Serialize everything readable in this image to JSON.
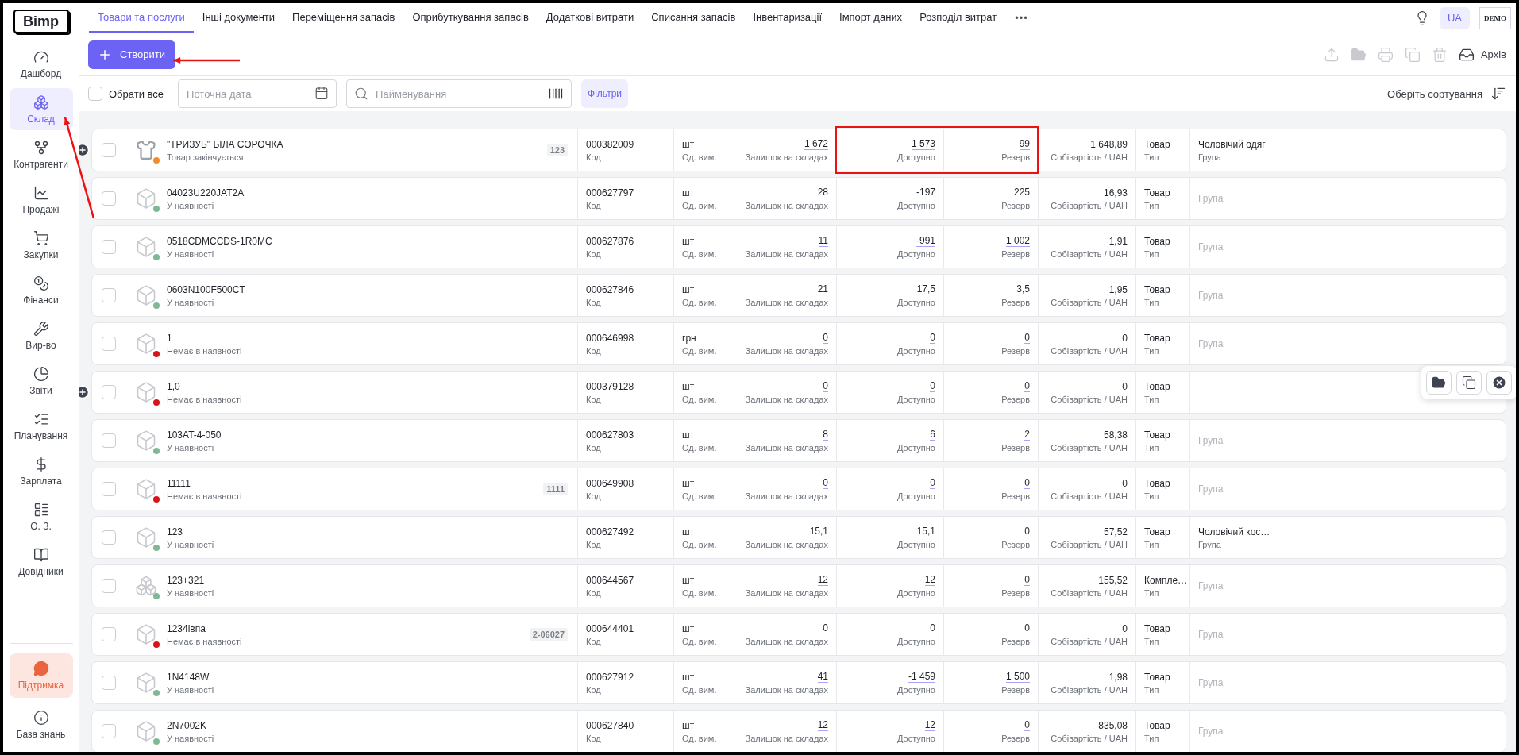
{
  "logo": "Bimp",
  "sidebar": {
    "items": [
      {
        "label": "Дашборд",
        "selected": false,
        "annotated": false
      },
      {
        "label": "Склад",
        "selected": true,
        "annotated": true
      },
      {
        "label": "Контрагенти",
        "selected": false,
        "annotated": false
      },
      {
        "label": "Продажі",
        "selected": false,
        "annotated": false
      },
      {
        "label": "Закупки",
        "selected": false,
        "annotated": false
      },
      {
        "label": "Фінанси",
        "selected": false,
        "annotated": false
      },
      {
        "label": "Вир-во",
        "selected": false,
        "annotated": false
      },
      {
        "label": "Звіти",
        "selected": false,
        "annotated": false
      },
      {
        "label": "Планування",
        "selected": false,
        "annotated": false
      },
      {
        "label": "Зарплата",
        "selected": false,
        "annotated": false
      },
      {
        "label": "О. З.",
        "selected": false,
        "annotated": false
      },
      {
        "label": "Довідники",
        "selected": false,
        "annotated": false
      }
    ],
    "bottom": [
      {
        "label": "Підтримка",
        "kind": "support"
      },
      {
        "label": "База знань",
        "kind": "plain"
      }
    ]
  },
  "tabs": [
    {
      "label": "Товари та послуги",
      "selected": true
    },
    {
      "label": "Інші документи",
      "selected": false
    },
    {
      "label": "Переміщення запасів",
      "selected": false
    },
    {
      "label": "Оприбуткування запасів",
      "selected": false
    },
    {
      "label": "Додаткові витрати",
      "selected": false
    },
    {
      "label": "Списання запасів",
      "selected": false
    },
    {
      "label": "Інвентаризації",
      "selected": false
    },
    {
      "label": "Імпорт даних",
      "selected": false
    },
    {
      "label": "Розподіл витрат",
      "selected": false
    }
  ],
  "tabs_more": "•••",
  "language": "UA",
  "account_logo": "DEMO",
  "toolbar": {
    "create": {
      "label": "Створити",
      "annotated": true
    },
    "archive": "Архів"
  },
  "filters": {
    "select_all": {
      "label": "Обрати все",
      "checked": false
    },
    "date": {
      "placeholder": "Поточна дата"
    },
    "search": {
      "placeholder": "Найменування"
    },
    "filters_button": "Фільтри",
    "sort": "Оберіть сортування"
  },
  "rows": [
    {
      "name": "\"ТРИЗУБ\" БІЛА СОРОЧКА",
      "status": "Товар закінчується",
      "color": "#f28c28",
      "kind": "shirt",
      "badge": "123",
      "code": "000382009",
      "code_label": "Код",
      "unit": "шт",
      "unit_label": "Од. вим.",
      "stock": "1 672",
      "stock_label": "Залишок на складах",
      "available": "1 573",
      "available_label": "Доступно",
      "reserve": "99",
      "reserve_label": "Резерв",
      "cost": "1 648,89",
      "cost_label": "Собівартість / UAH",
      "type": "Товар",
      "type_label": "Тип",
      "group": "Чоловічий одяг",
      "group_label": "Група",
      "expand_button": true,
      "hovered": false,
      "highlighted": true,
      "checked": false
    },
    {
      "name": "04023U220JAT2A",
      "status": "У наявності",
      "color": "#7fb894",
      "kind": "box",
      "code": "000627797",
      "code_label": "Код",
      "unit": "шт",
      "unit_label": "Од. вим.",
      "stock": "28",
      "stock_label": "Залишок на складах",
      "available": "-197",
      "available_label": "Доступно",
      "reserve": "225",
      "reserve_label": "Резерв",
      "cost": "16,93",
      "cost_label": "Собівартість / UAH",
      "type": "Товар",
      "type_label": "Тип",
      "group_label": "Група",
      "expand_button": false,
      "hovered": false,
      "highlighted": false,
      "checked": false
    },
    {
      "name": "0518CDMCCDS-1R0MC",
      "status": "У наявності",
      "color": "#7fb894",
      "kind": "box",
      "code": "000627876",
      "code_label": "Код",
      "unit": "шт",
      "unit_label": "Од. вим.",
      "stock": "11",
      "stock_label": "Залишок на складах",
      "available": "-991",
      "available_label": "Доступно",
      "reserve": "1 002",
      "reserve_label": "Резерв",
      "cost": "1,91",
      "cost_label": "Собівартість / UAH",
      "type": "Товар",
      "type_label": "Тип",
      "group_label": "Група",
      "expand_button": false,
      "hovered": false,
      "highlighted": false,
      "checked": false
    },
    {
      "name": "0603N100F500CT",
      "status": "У наявності",
      "color": "#7fb894",
      "kind": "box",
      "code": "000627846",
      "code_label": "Код",
      "unit": "шт",
      "unit_label": "Од. вим.",
      "stock": "21",
      "stock_label": "Залишок на складах",
      "available": "17,5",
      "available_label": "Доступно",
      "reserve": "3,5",
      "reserve_label": "Резерв",
      "cost": "1,95",
      "cost_label": "Собівартість / UAH",
      "type": "Товар",
      "type_label": "Тип",
      "group_label": "Група",
      "expand_button": false,
      "hovered": false,
      "highlighted": false,
      "checked": false
    },
    {
      "name": "1",
      "status": "Немає в наявності",
      "color": "#d7141a",
      "kind": "box",
      "code": "000646998",
      "code_label": "Код",
      "unit": "грн",
      "unit_label": "Од. вим.",
      "stock": "0",
      "stock_label": "Залишок на складах",
      "available": "0",
      "available_label": "Доступно",
      "reserve": "0",
      "reserve_label": "Резерв",
      "cost": "0",
      "cost_label": "Собівартість / UAH",
      "type": "Товар",
      "type_label": "Тип",
      "group_label": "Група",
      "expand_button": false,
      "hovered": false,
      "highlighted": false,
      "checked": false
    },
    {
      "name": "1,0",
      "status": "Немає в наявності",
      "color": "#d7141a",
      "kind": "box",
      "code": "000379128",
      "code_label": "Код",
      "unit": "шт",
      "unit_label": "Од. вим.",
      "stock": "0",
      "stock_label": "Залишок на складах",
      "available": "0",
      "available_label": "Доступно",
      "reserve": "0",
      "reserve_label": "Резерв",
      "cost": "0",
      "cost_label": "Собівартість / UAH",
      "type": "Товар",
      "type_label": "Тип",
      "expand_button": true,
      "hovered": true,
      "highlighted": false,
      "checked": false
    },
    {
      "name": "103AT-4-050",
      "status": "У наявності",
      "color": "#7fb894",
      "kind": "box",
      "code": "000627803",
      "code_label": "Код",
      "unit": "шт",
      "unit_label": "Од. вим.",
      "stock": "8",
      "stock_label": "Залишок на складах",
      "available": "6",
      "available_label": "Доступно",
      "reserve": "2",
      "reserve_label": "Резерв",
      "cost": "58,38",
      "cost_label": "Собівартість / UAH",
      "type": "Товар",
      "type_label": "Тип",
      "group_label": "Група",
      "expand_button": false,
      "hovered": false,
      "highlighted": false,
      "checked": false
    },
    {
      "name": "11111",
      "status": "Немає в наявності",
      "color": "#d7141a",
      "kind": "box",
      "badge": "1111",
      "code": "000649908",
      "code_label": "Код",
      "unit": "шт",
      "unit_label": "Од. вим.",
      "stock": "0",
      "stock_label": "Залишок на складах",
      "available": "0",
      "available_label": "Доступно",
      "reserve": "0",
      "reserve_label": "Резерв",
      "cost": "0",
      "cost_label": "Собівартість / UAH",
      "type": "Товар",
      "type_label": "Тип",
      "group_label": "Група",
      "expand_button": false,
      "hovered": false,
      "highlighted": false,
      "checked": false
    },
    {
      "name": "123",
      "status": "У наявності",
      "color": "#7fb894",
      "kind": "box",
      "code": "000627492",
      "code_label": "Код",
      "unit": "шт",
      "unit_label": "Од. вим.",
      "stock": "15,1",
      "stock_label": "Залишок на складах",
      "available": "15,1",
      "available_label": "Доступно",
      "reserve": "0",
      "reserve_label": "Резерв",
      "cost": "57,52",
      "cost_label": "Собівартість / UAH",
      "type": "Товар",
      "type_label": "Тип",
      "group": "Чоловічий кос…",
      "group_label": "Група",
      "expand_button": false,
      "hovered": false,
      "highlighted": false,
      "checked": false
    },
    {
      "name": "123+321",
      "status": "У наявності",
      "color": "#7fb894",
      "kind": "boxes",
      "code": "000644567",
      "code_label": "Код",
      "unit": "шт",
      "unit_label": "Од. вим.",
      "stock": "12",
      "stock_label": "Залишок на складах",
      "available": "12",
      "available_label": "Доступно",
      "reserve": "0",
      "reserve_label": "Резерв",
      "cost": "155,52",
      "cost_label": "Собівартість / UAH",
      "type": "Компле…",
      "type_label": "Тип",
      "group_label": "Група",
      "expand_button": false,
      "hovered": false,
      "highlighted": false,
      "checked": false
    },
    {
      "name": "1234івпа",
      "status": "Немає в наявності",
      "color": "#d7141a",
      "kind": "box",
      "badge": "2-06027",
      "code": "000644401",
      "code_label": "Код",
      "unit": "шт",
      "unit_label": "Од. вим.",
      "stock": "0",
      "stock_label": "Залишок на складах",
      "available": "0",
      "available_label": "Доступно",
      "reserve": "0",
      "reserve_label": "Резерв",
      "cost": "0",
      "cost_label": "Собівартість / UAH",
      "type": "Товар",
      "type_label": "Тип",
      "group_label": "Група",
      "expand_button": false,
      "hovered": false,
      "highlighted": false,
      "checked": false
    },
    {
      "name": "1N4148W",
      "status": "У наявності",
      "color": "#7fb894",
      "kind": "box",
      "code": "000627912",
      "code_label": "Код",
      "unit": "шт",
      "unit_label": "Од. вим.",
      "stock": "41",
      "stock_label": "Залишок на складах",
      "available": "-1 459",
      "available_label": "Доступно",
      "reserve": "1 500",
      "reserve_label": "Резерв",
      "cost": "1,98",
      "cost_label": "Собівартість / UAH",
      "type": "Товар",
      "type_label": "Тип",
      "group_label": "Група",
      "expand_button": false,
      "hovered": false,
      "highlighted": false,
      "checked": false
    },
    {
      "name": "2N7002K",
      "status": "У наявності",
      "color": "#7fb894",
      "kind": "box",
      "code": "000627840",
      "code_label": "Код",
      "unit": "шт",
      "unit_label": "Од. вим.",
      "stock": "12",
      "stock_label": "Залишок на складах",
      "available": "12",
      "available_label": "Доступно",
      "reserve": "0",
      "reserve_label": "Резерв",
      "cost": "835,08",
      "cost_label": "Собівартість / UAH",
      "type": "Товар",
      "type_label": "Тип",
      "group_label": "Група",
      "expand_button": false,
      "hovered": false,
      "highlighted": false,
      "checked": false
    }
  ]
}
